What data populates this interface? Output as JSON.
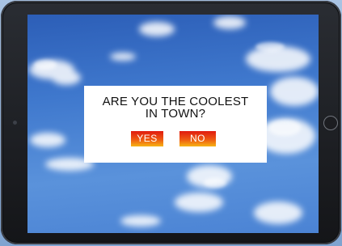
{
  "dialog": {
    "question_line1": "ARE YOU THE COOLEST",
    "question_line2": "IN TOWN?",
    "yes_label": "YES",
    "no_label": "NO"
  },
  "colors": {
    "button_gradient_top": "#e01a10",
    "button_gradient_bottom": "#f6b414",
    "dialog_background": "#ffffff",
    "sky": "#3f78cd",
    "device_frame": "#1c1d21"
  },
  "icons": {
    "camera": "camera-icon",
    "home_button": "home-button-icon"
  }
}
